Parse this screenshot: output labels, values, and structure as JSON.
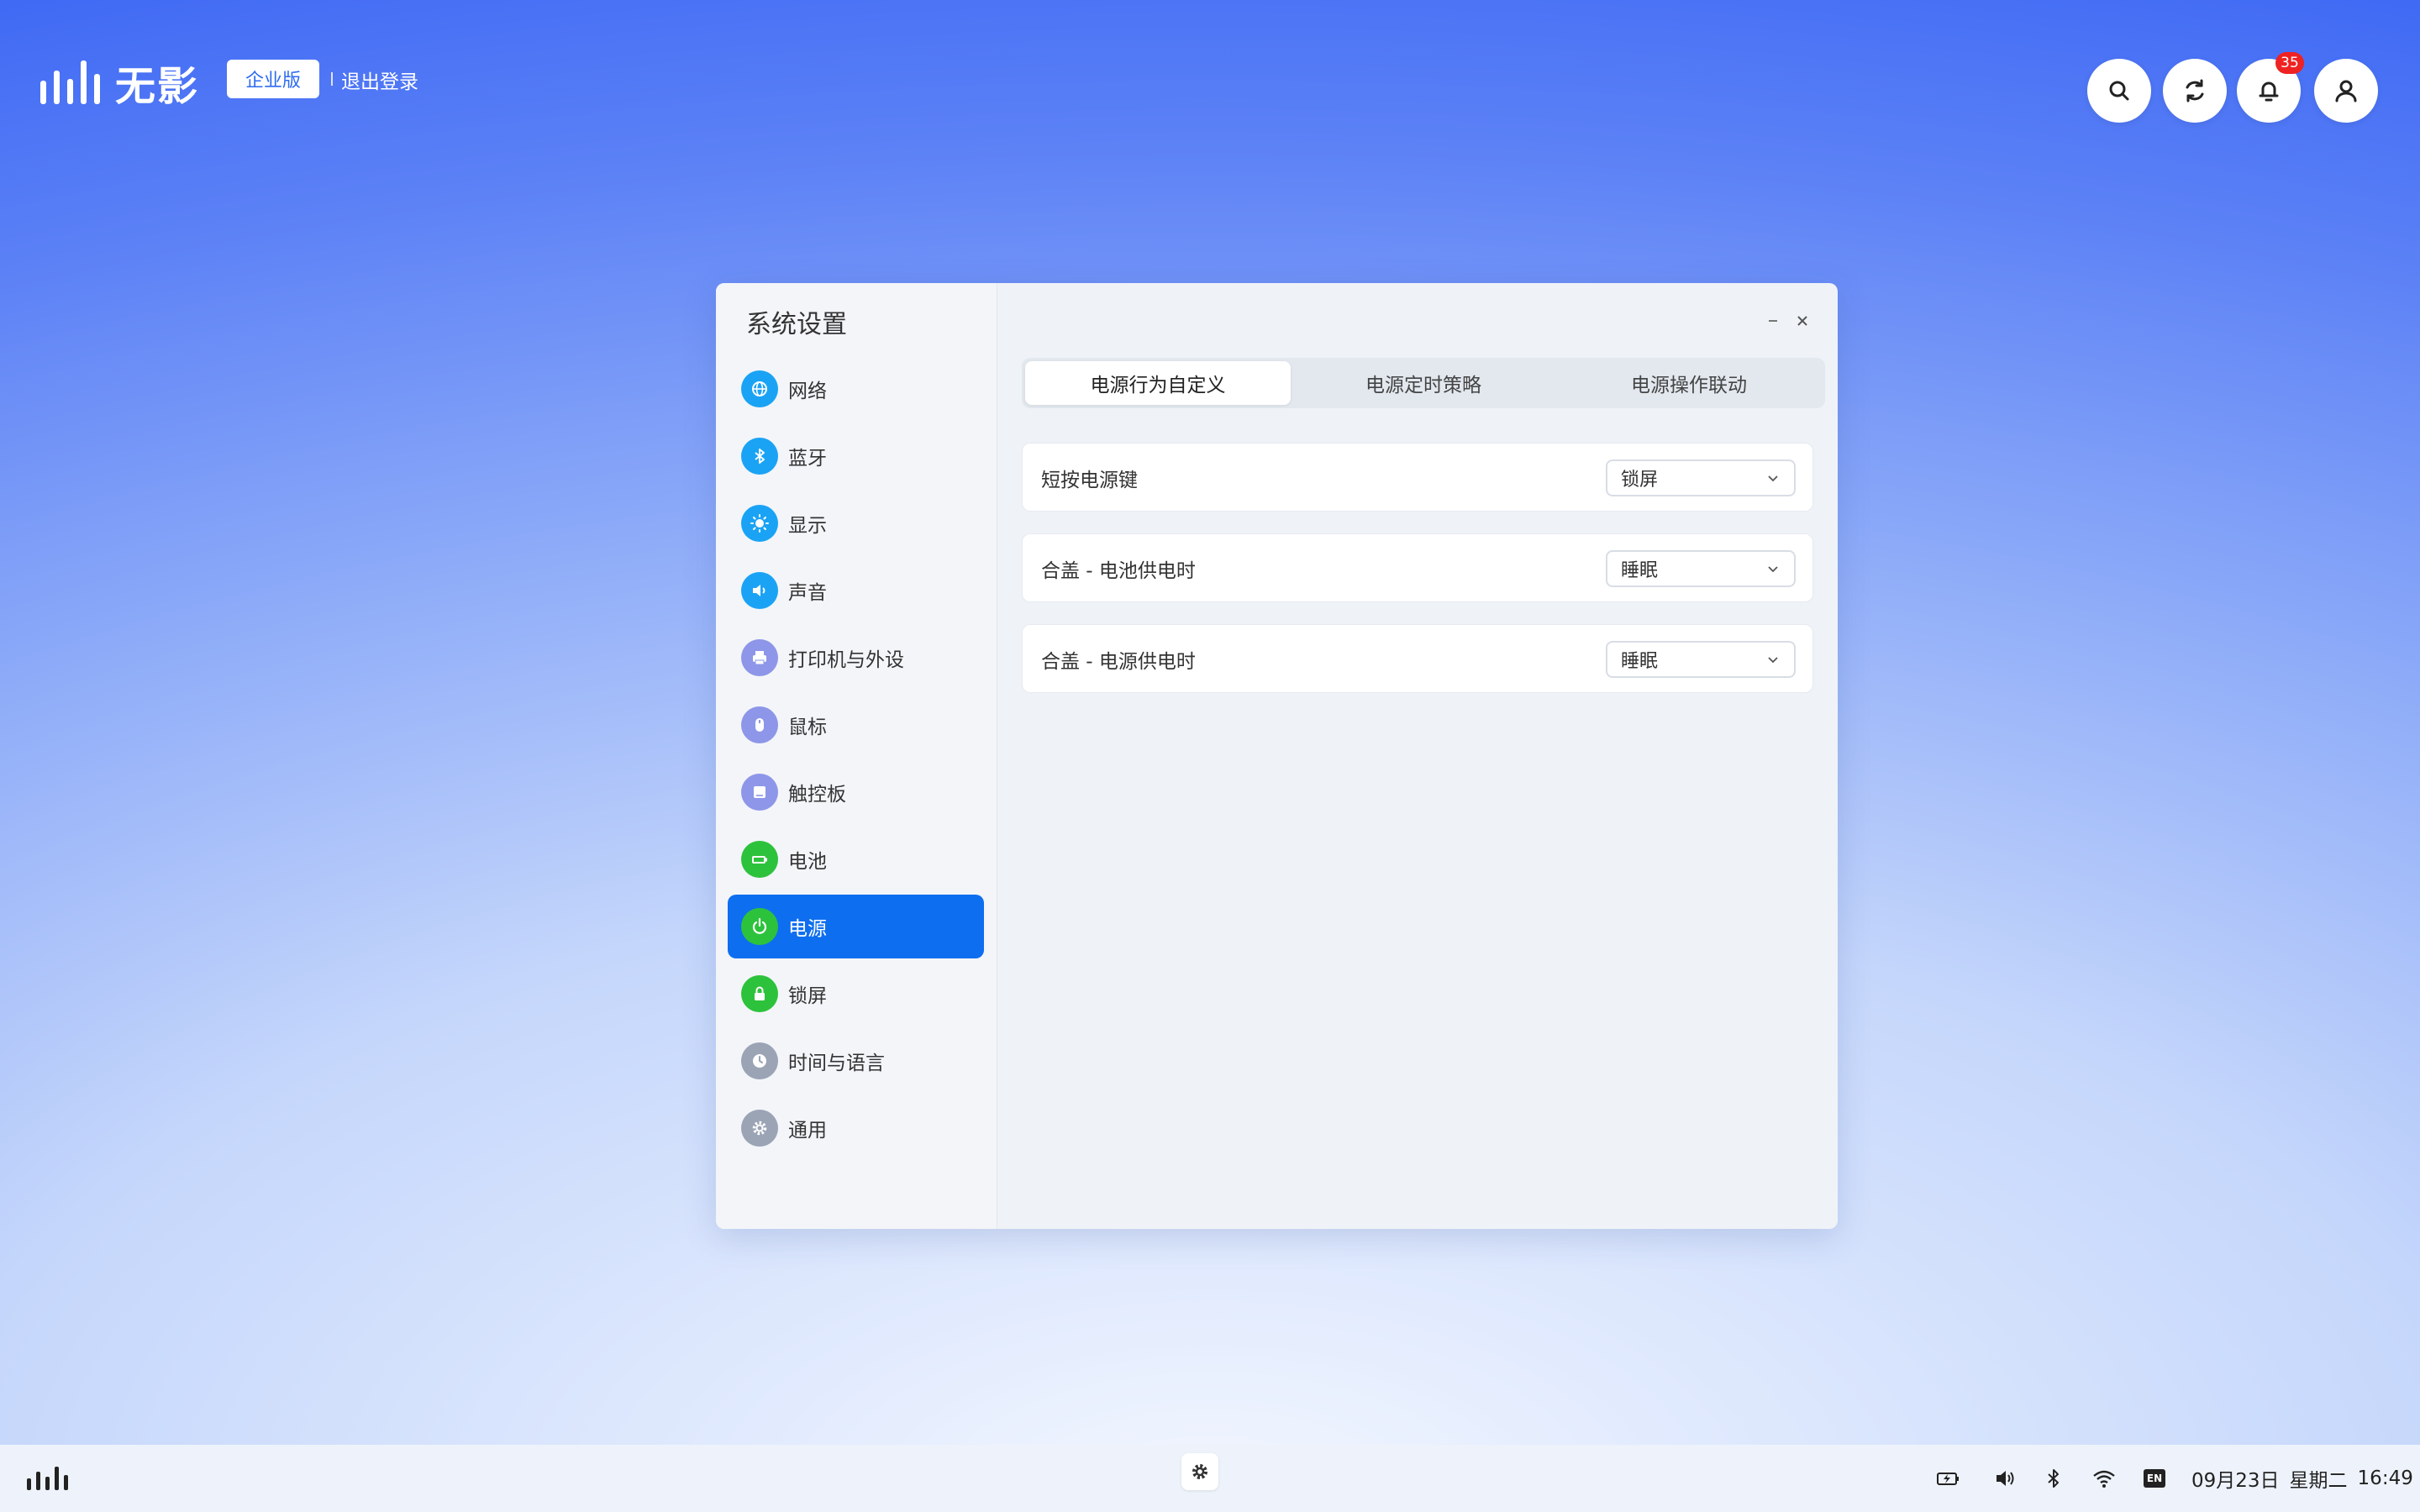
{
  "header": {
    "brand": "无影",
    "edition": "企业版",
    "logout": "退出登录",
    "notification_count": "35",
    "icons": [
      "search-icon",
      "refresh-icon",
      "bell-icon",
      "user-icon"
    ]
  },
  "window": {
    "title": "系统设置",
    "sidebar": [
      {
        "label": "网络",
        "icon": "globe-icon",
        "color": "#1aa3f5"
      },
      {
        "label": "蓝牙",
        "icon": "bluetooth-icon",
        "color": "#1aa3f5"
      },
      {
        "label": "显示",
        "icon": "sun-icon",
        "color": "#1aa3f5"
      },
      {
        "label": "声音",
        "icon": "speaker-icon",
        "color": "#1aa3f5"
      },
      {
        "label": "打印机与外设",
        "icon": "printer-icon",
        "color": "#8d96e8"
      },
      {
        "label": "鼠标",
        "icon": "mouse-icon",
        "color": "#8d96e8"
      },
      {
        "label": "触控板",
        "icon": "touchpad-icon",
        "color": "#8d96e8"
      },
      {
        "label": "电池",
        "icon": "battery-icon",
        "color": "#2dc23c"
      },
      {
        "label": "电源",
        "icon": "power-icon",
        "color": "#2dc23c",
        "active": true
      },
      {
        "label": "锁屏",
        "icon": "lock-icon",
        "color": "#2dc23c"
      },
      {
        "label": "时间与语言",
        "icon": "clock-icon",
        "color": "#9aa4b5"
      },
      {
        "label": "通用",
        "icon": "gear-icon",
        "color": "#9aa4b5"
      }
    ],
    "tabs": [
      {
        "label": "电源行为自定义",
        "active": true
      },
      {
        "label": "电源定时策略",
        "active": false
      },
      {
        "label": "电源操作联动",
        "active": false
      }
    ],
    "rows": [
      {
        "label": "短按电源键",
        "value": "锁屏"
      },
      {
        "label": "合盖 - 电池供电时",
        "value": "睡眠"
      },
      {
        "label": "合盖 - 电源供电时",
        "value": "睡眠"
      }
    ]
  },
  "taskbar": {
    "tray_icons": [
      "battery-charging-icon",
      "volume-icon",
      "bluetooth-icon",
      "wifi-icon",
      "input-method-icon"
    ],
    "input_method": "EN",
    "date": "09月23日",
    "weekday": "星期二",
    "time": "16:49"
  },
  "colors": {
    "accent": "#0e6ef0",
    "badge": "#ee2222"
  }
}
